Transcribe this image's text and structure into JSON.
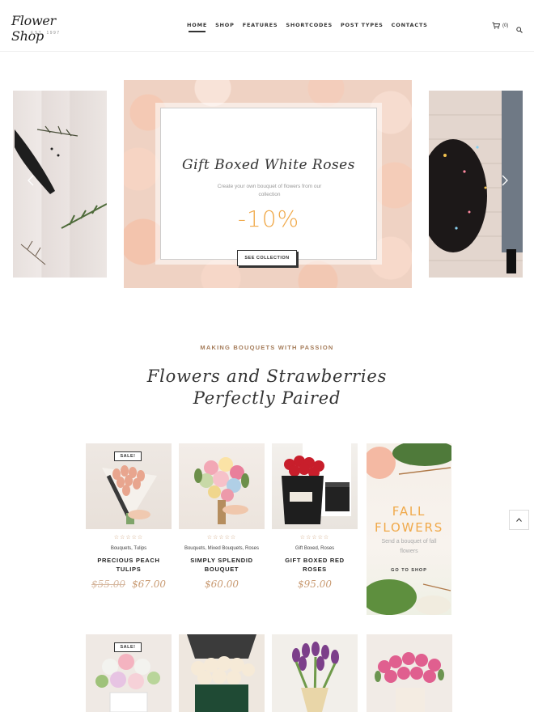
{
  "logo": {
    "script": "Flower Shop",
    "sub": "EST. 1997"
  },
  "nav": {
    "items": [
      {
        "label": "HOME"
      },
      {
        "label": "SHOP"
      },
      {
        "label": "FEATURES"
      },
      {
        "label": "SHORTCODES"
      },
      {
        "label": "POST TYPES"
      },
      {
        "label": "CONTACTS"
      }
    ],
    "active": "HOME"
  },
  "cart": {
    "count": "(0)",
    "icon": "cart-icon"
  },
  "search": {
    "icon": "search-icon"
  },
  "slider": {
    "title": "Gift Boxed White Roses",
    "subtitle": "Create your own bouquet of flowers from our collection",
    "discount": "-10%",
    "button": "SEE COLLECTION"
  },
  "section": {
    "eyebrow": "MAKING BOUQUETS WITH PASSION",
    "title_line1": "Flowers and Strawberries",
    "title_line2": "Perfectly Paired"
  },
  "products": [
    {
      "sale": "SALE!",
      "stars": "☆☆☆☆☆",
      "categories": "Bouquets, Tulips",
      "name": "PRECIOUS PEACH TULIPS",
      "old_price": "$55.00",
      "price": "$67.00"
    },
    {
      "stars": "☆☆☆☆☆",
      "categories": "Bouquets, Mixed Bouquets, Roses",
      "name": "SIMPLY SPLENDID BOUQUET",
      "price": "$60.00"
    },
    {
      "stars": "☆☆☆☆☆",
      "categories": "Gift Boxed, Roses",
      "name": "GIFT BOXED RED ROSES",
      "price": "$95.00"
    }
  ],
  "promo": {
    "title_line1": "FALL",
    "title_line2": "FLOWERS",
    "text": "Send a bouquet of fall flowers",
    "link": "GO TO SHOP"
  },
  "bottom_products": [
    {
      "sale": "SALE!"
    }
  ],
  "colors": {
    "accent": "#f0a94a",
    "price": "#c99b73",
    "eyebrow": "#a57c5a"
  }
}
